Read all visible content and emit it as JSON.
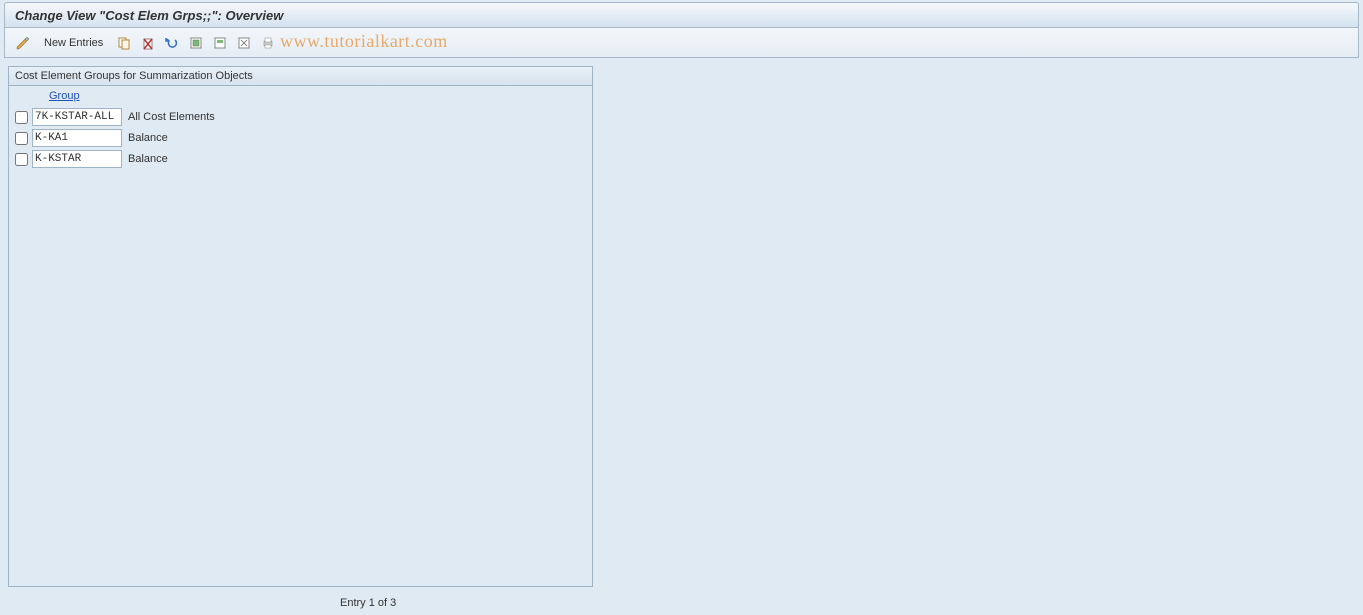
{
  "titlebar": {
    "title": "Change View \"Cost Elem Grps;;\": Overview"
  },
  "toolbar": {
    "new_entries_label": "New Entries"
  },
  "watermark": "www.tutorialkart.com",
  "panel": {
    "title": "Cost Element Groups for Summarization Objects",
    "column_header": "Group",
    "rows": [
      {
        "code": "7K-KSTAR-ALL",
        "desc": "All Cost Elements"
      },
      {
        "code": "K-KA1",
        "desc": "Balance"
      },
      {
        "code": "K-KSTAR",
        "desc": "Balance"
      }
    ]
  },
  "footer": {
    "entry_text": "Entry 1 of 3"
  }
}
